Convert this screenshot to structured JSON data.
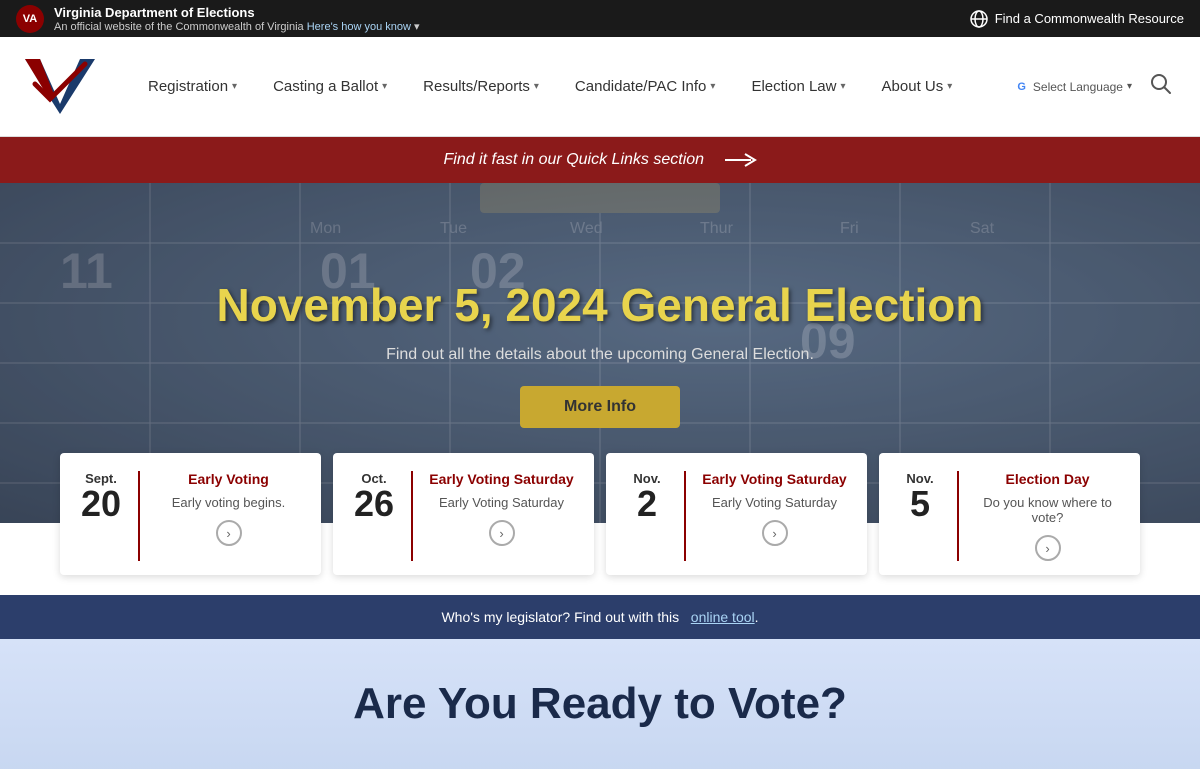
{
  "topbar": {
    "agency_name": "Virginia Department of Elections",
    "official_text": "An official website of the Commonwealth of Virginia",
    "heres_how": "Here's how you know",
    "find_resource": "Find a Commonwealth Resource"
  },
  "nav": {
    "logo_alt": "Virginia Department of Elections Logo",
    "links": [
      {
        "label": "Registration",
        "has_dropdown": true
      },
      {
        "label": "Casting a Ballot",
        "has_dropdown": true
      },
      {
        "label": "Results/Reports",
        "has_dropdown": true
      },
      {
        "label": "Candidate/PAC Info",
        "has_dropdown": true
      },
      {
        "label": "Election Law",
        "has_dropdown": true
      },
      {
        "label": "About Us",
        "has_dropdown": true
      }
    ]
  },
  "quick_links": {
    "text": "Find it fast in our Quick Links section"
  },
  "hero": {
    "title": "November 5, 2024 General Election",
    "subtitle": "Find out all the details about the upcoming General Election.",
    "button_label": "More Info"
  },
  "event_cards": [
    {
      "month": "Sept.",
      "day": "20",
      "title": "Early Voting",
      "desc": "Early voting begins.",
      "arrow": "→"
    },
    {
      "month": "Oct.",
      "day": "26",
      "title": "Early Voting Saturday",
      "desc": "Early Voting Saturday",
      "arrow": "→"
    },
    {
      "month": "Nov.",
      "day": "2",
      "title": "Early Voting Saturday",
      "desc": "Early Voting Saturday",
      "arrow": "→"
    },
    {
      "month": "Nov.",
      "day": "5",
      "title": "Election Day",
      "desc": "Do you know where to vote?",
      "arrow": "→"
    }
  ],
  "legislator_bar": {
    "text": "Who's my legislator? Find out with this",
    "link_text": "online tool",
    "suffix": "."
  },
  "ready_section": {
    "title": "Are You Ready to Vote?"
  },
  "select_language": "Select Language"
}
